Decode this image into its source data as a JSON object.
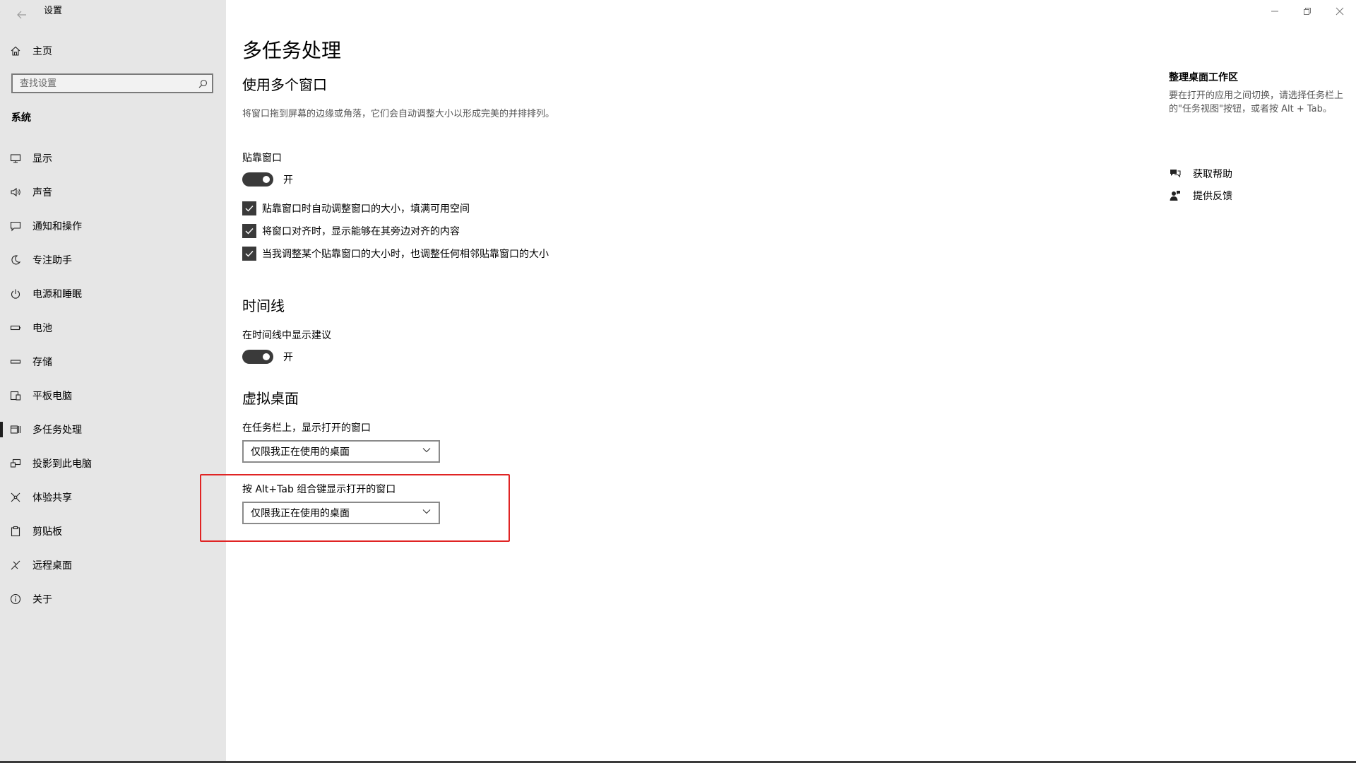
{
  "window": {
    "title": "设置",
    "back_icon": "back-arrow-icon",
    "controls": [
      "minimize-icon",
      "restore-icon",
      "close-icon"
    ]
  },
  "sidebar": {
    "home_label": "主页",
    "search_placeholder": "查找设置",
    "section_title": "系统",
    "items": [
      {
        "label": "显示",
        "icon": "display-icon"
      },
      {
        "label": "声音",
        "icon": "speaker-icon"
      },
      {
        "label": "通知和操作",
        "icon": "notification-icon"
      },
      {
        "label": "专注助手",
        "icon": "moon-icon"
      },
      {
        "label": "电源和睡眠",
        "icon": "power-icon"
      },
      {
        "label": "电池",
        "icon": "battery-icon"
      },
      {
        "label": "存储",
        "icon": "storage-icon"
      },
      {
        "label": "平板电脑",
        "icon": "tablet-icon"
      },
      {
        "label": "多任务处理",
        "icon": "multitasking-icon",
        "active": true
      },
      {
        "label": "投影到此电脑",
        "icon": "project-icon"
      },
      {
        "label": "体验共享",
        "icon": "share-experience-icon"
      },
      {
        "label": "剪贴板",
        "icon": "clipboard-icon"
      },
      {
        "label": "远程桌面",
        "icon": "remote-desktop-icon"
      },
      {
        "label": "关于",
        "icon": "info-icon"
      }
    ]
  },
  "main": {
    "page_title": "多任务处理",
    "windows_section": {
      "heading": "使用多个窗口",
      "description": "将窗口拖到屏幕的边缘或角落，它们会自动调整大小以形成完美的并排排列。",
      "snap_label": "贴靠窗口",
      "snap_toggle_state": "开",
      "checkboxes": [
        {
          "label": "贴靠窗口时自动调整窗口的大小，填满可用空间",
          "checked": true
        },
        {
          "label": "将窗口对齐时，显示能够在其旁边对齐的内容",
          "checked": true
        },
        {
          "label": "当我调整某个贴靠窗口的大小时，也调整任何相邻贴靠窗口的大小",
          "checked": true
        }
      ]
    },
    "timeline_section": {
      "heading": "时间线",
      "label": "在时间线中显示建议",
      "toggle_state": "开"
    },
    "virtual_desktops_section": {
      "heading": "虚拟桌面",
      "taskbar_label": "在任务栏上，显示打开的窗口",
      "taskbar_value": "仅限我正在使用的桌面",
      "alttab_label": "按 Alt+Tab 组合键显示打开的窗口",
      "alttab_value": "仅限我正在使用的桌面"
    }
  },
  "right_panel": {
    "title": "整理桌面工作区",
    "text": "要在打开的应用之间切换，请选择任务栏上的\"任务视图\"按钮，或者按 Alt + Tab。",
    "links": [
      {
        "label": "获取帮助",
        "icon": "help-chat-icon"
      },
      {
        "label": "提供反馈",
        "icon": "feedback-icon"
      }
    ]
  },
  "colors": {
    "sidebar_bg": "#e6e6e6",
    "toggle_on": "#3a3a3a",
    "highlight_border": "#e02424"
  }
}
